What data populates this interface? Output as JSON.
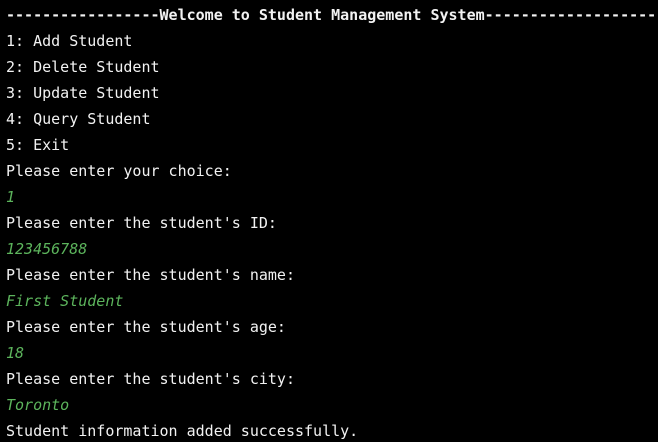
{
  "console": {
    "header": "-----------------Welcome to Student Management System-------------------",
    "menu": [
      "1: Add Student",
      "2: Delete Student",
      "3: Update Student",
      "4: Query Student",
      "5: Exit"
    ],
    "prompt_choice": "Please enter your choice:",
    "input_choice": "1",
    "prompt_id": "Please enter the student's ID:",
    "input_id": "123456788",
    "prompt_name": "Please enter the student's name:",
    "input_name": "First Student",
    "prompt_age": "Please enter the student's age:",
    "input_age": "18",
    "prompt_city": "Please enter the student's city:",
    "input_city": "Toronto",
    "result": "Student information added successfully."
  },
  "colors": {
    "background": "#000000",
    "output_text": "#f2f2f2",
    "user_input": "#5cb45c"
  }
}
